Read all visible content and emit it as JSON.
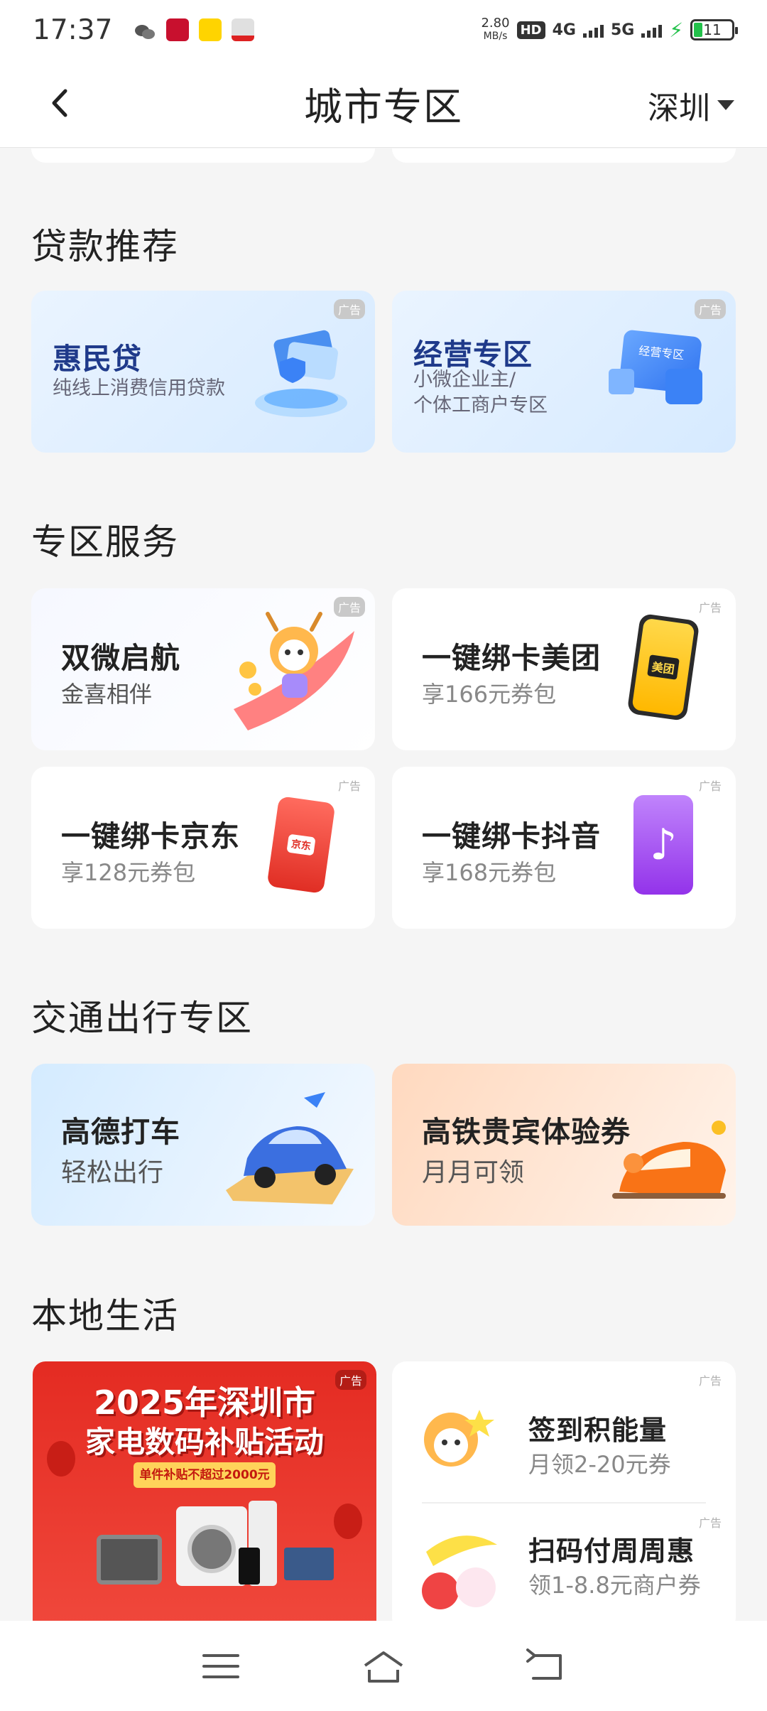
{
  "status_bar": {
    "time": "17:37",
    "net_speed_top": "2.80",
    "net_speed_unit": "MB/s",
    "hd": "HD",
    "net1": "4G",
    "net2": "5G",
    "battery": "11",
    "icons": [
      "wechat-icon",
      "bank-app-icon",
      "yellow-app-icon",
      "union-app-icon"
    ]
  },
  "header": {
    "title": "城市专区",
    "city": "深圳"
  },
  "ad_label": "广告",
  "loan_section": {
    "title": "贷款推荐",
    "cards": [
      {
        "title": "惠民贷",
        "subtitle": "纯线上消费信用贷款"
      },
      {
        "title": "经营专区",
        "subtitle_line1": "小微企业主/",
        "subtitle_line2": "个体工商户专区",
        "badge": "经营专区"
      }
    ]
  },
  "service_section": {
    "title": "专区服务",
    "cards": [
      {
        "title": "双微启航",
        "subtitle": "金喜相伴"
      },
      {
        "title": "一键绑卡美团",
        "subtitle": "享166元券包",
        "badge": "美团"
      },
      {
        "title": "一键绑卡京东",
        "subtitle": "享128元券包",
        "badge": "京东"
      },
      {
        "title": "一键绑卡抖音",
        "subtitle": "享168元券包"
      }
    ]
  },
  "transport_section": {
    "title": "交通出行专区",
    "cards": [
      {
        "title": "高德打车",
        "subtitle": "轻松出行"
      },
      {
        "title": "高铁贵宾体验券",
        "subtitle": "月月可领"
      }
    ]
  },
  "local_section": {
    "title": "本地生活",
    "banner": {
      "line1": "2025年深圳市",
      "line2": "家电数码补贴活动",
      "ribbon": "单件补贴不超过2000元"
    },
    "items": [
      {
        "title": "签到积能量",
        "subtitle": "月领2-20元券"
      },
      {
        "title": "扫码付周周惠",
        "subtitle": "领1-8.8元商户券"
      }
    ]
  },
  "colors": {
    "accent_blue": "#1f3a8a",
    "banner_red": "#e42b22",
    "background": "#f5f5f5"
  },
  "nav": [
    "menu-icon",
    "home-icon",
    "back-icon"
  ]
}
